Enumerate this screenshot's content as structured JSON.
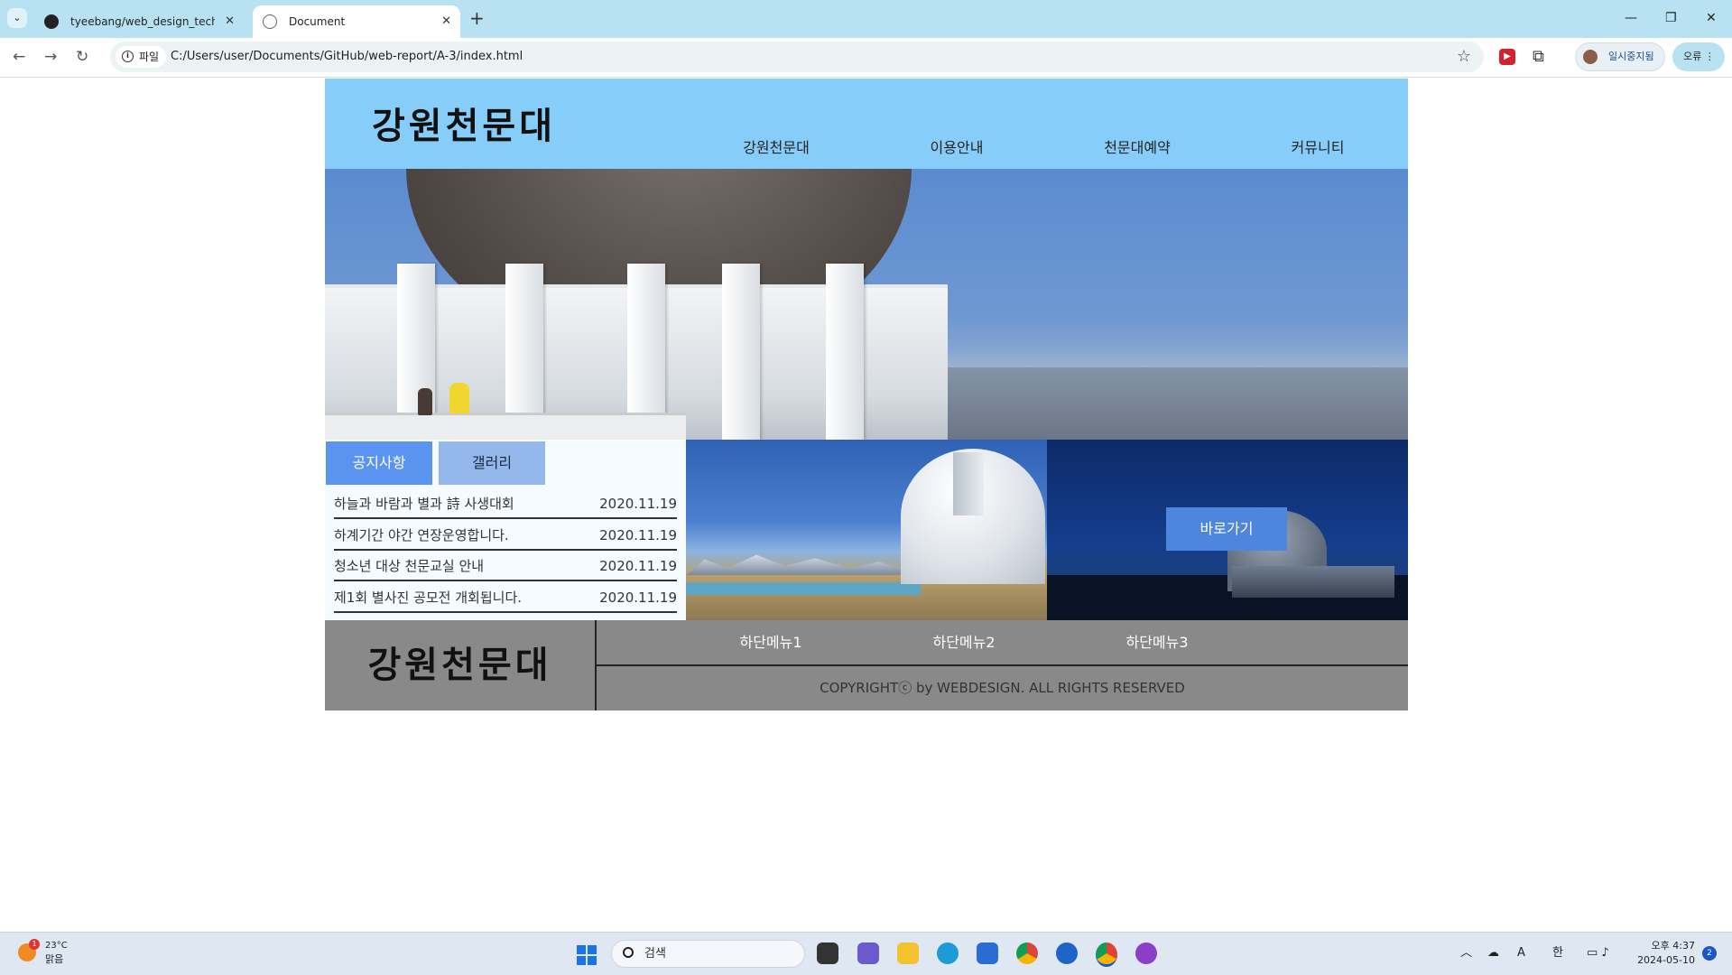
{
  "browser": {
    "tabs": [
      {
        "title": "tyeebang/web_design_technic",
        "active": false
      },
      {
        "title": "Document",
        "active": true
      }
    ],
    "address": {
      "chip": "파일",
      "url": "C:/Users/user/Documents/GitHub/web-report/A-3/index.html"
    },
    "profile_label": "일시중지됨",
    "error_label": "오류"
  },
  "page": {
    "logo": "강원천문대",
    "nav": [
      "강원천문대",
      "이용안내",
      "천문대예약",
      "커뮤니티"
    ],
    "board": {
      "tabs": [
        "공지사항",
        "갤러리"
      ],
      "notices": [
        {
          "title": "하늘과 바람과 별과 詩 사생대회",
          "date": "2020.11.19"
        },
        {
          "title": "하계기간 야간 연장운영합니다.",
          "date": "2020.11.19"
        },
        {
          "title": "청소년 대상 천문교실 안내",
          "date": "2020.11.19"
        },
        {
          "title": "제1회 별사진 공모전 개회됩니다.",
          "date": "2020.11.19"
        }
      ]
    },
    "banner": {
      "button": "바로가기"
    },
    "footer": {
      "logo": "강원천문대",
      "menu": [
        "하단메뉴1",
        "하단메뉴2",
        "하단메뉴3"
      ],
      "copyright": "COPYRIGHTⓒ by WEBDESIGN. ALL RIGHTS RESERVED"
    },
    "colors": {
      "header": "#87cdf9",
      "tab_active": "#5b93f0",
      "tab_inactive": "#95b8ec",
      "footer": "#898989",
      "button": "#4e86de"
    }
  },
  "taskbar": {
    "weather": {
      "temp": "23°C",
      "condition": "맑음",
      "badge": "1"
    },
    "search_placeholder": "검색",
    "ime": "한",
    "clock": {
      "time": "오후 4:37",
      "date": "2024-05-10"
    },
    "notifications": "2",
    "app_icons": [
      "task-view-icon",
      "chat-icon",
      "file-explorer-icon",
      "edge-icon",
      "store-icon",
      "chrome-icon",
      "app-icon",
      "chrome-profile-icon",
      "github-desktop-icon"
    ]
  }
}
